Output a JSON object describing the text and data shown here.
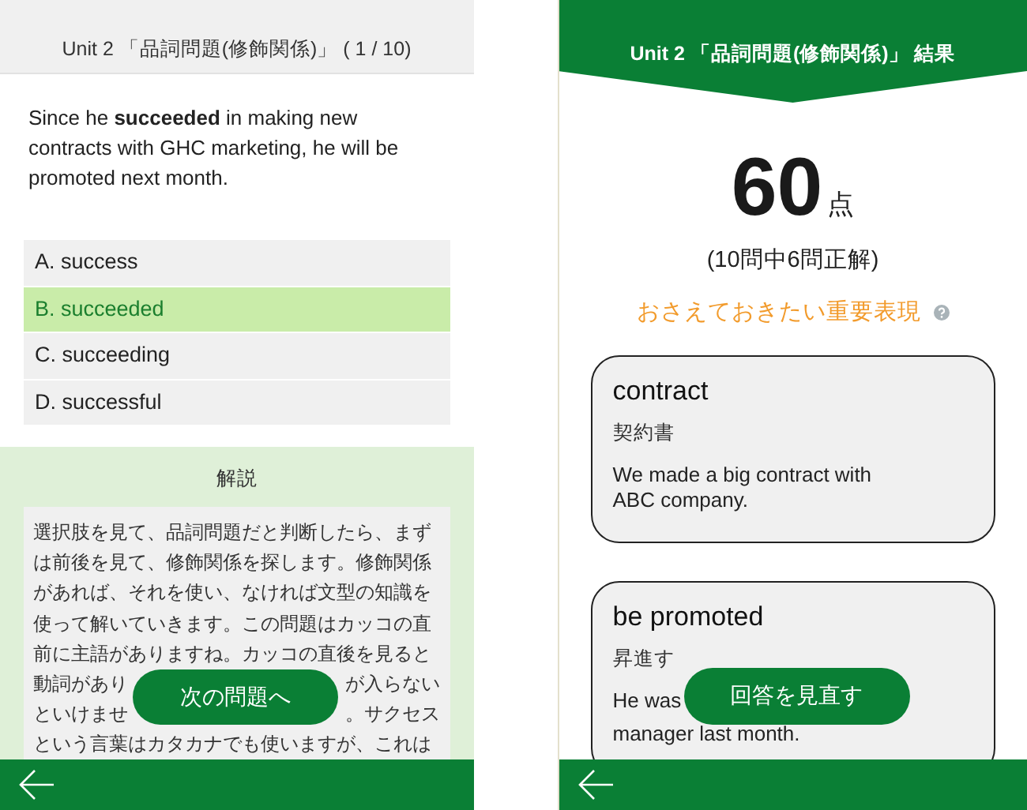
{
  "quiz_screen": {
    "title": "Unit 2 「品詞問題(修飾関係)」 ( 1 / 10)",
    "question": "Since he **succeeded** in making new contracts with GHC marketing, he will be promoted next month.",
    "options": [
      {
        "label": "A. success",
        "selected": false
      },
      {
        "label": "B. succeeded",
        "selected": true
      },
      {
        "label": "C. succeeding",
        "selected": false
      },
      {
        "label": "D. successful",
        "selected": false
      }
    ],
    "explanation": {
      "heading": "解説",
      "lines": [
        {
          "parts": [
            "選択肢を見て、品詞問題だと判断したら、まず"
          ]
        },
        {
          "parts": [
            "は前後を見て、修飾関係を探します。修飾関係"
          ]
        },
        {
          "parts": [
            "があれば、それを使い、なければ文型の知識を"
          ]
        },
        {
          "parts": [
            "使って解いていきます。この問題はカッコの直"
          ]
        },
        {
          "parts": [
            "前に主語がありますね。カッコの直後を見ると"
          ]
        },
        {
          "parts": [
            "動詞があり",
            "が入らない"
          ]
        },
        {
          "parts": [
            "といけませ",
            "。サクセス"
          ]
        },
        {
          "parts": [
            "という言葉はカタカナでも使いますが、これは"
          ]
        }
      ]
    },
    "next_button": "次の問題へ"
  },
  "result_screen": {
    "title": "Unit 2 「品詞問題(修飾関係)」 結果",
    "score": "60",
    "score_unit": "点",
    "summary": "(10問中6問正解)",
    "key_heading": "おさえておきたい重要表現",
    "cards": [
      {
        "term": "contract",
        "meaning": "契約書",
        "examples": [
          "We made a big contract with ABC company."
        ]
      },
      {
        "term": "be promoted",
        "meaning": "昇進す",
        "examples": [
          "He was",
          "manager last month."
        ]
      }
    ],
    "review_button": "回答を見直す"
  }
}
